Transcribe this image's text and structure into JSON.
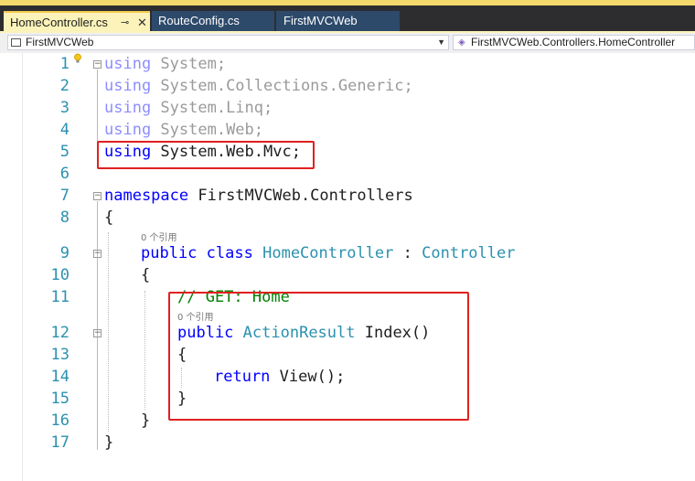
{
  "tabs": [
    {
      "label": "HomeController.cs",
      "active": true,
      "pin_icon": "pin-icon",
      "close_icon": "close-icon"
    },
    {
      "label": "RouteConfig.cs",
      "active": false
    },
    {
      "label": "FirstMVCWeb",
      "active": false
    }
  ],
  "navbar": {
    "project": "FirstMVCWeb",
    "type_scope": "FirstMVCWeb.Controllers.HomeController"
  },
  "editor": {
    "line_numbers": [
      "1",
      "2",
      "3",
      "4",
      "5",
      "6",
      "7",
      "8",
      "9",
      "10",
      "11",
      "12",
      "13",
      "14",
      "15",
      "16",
      "17"
    ],
    "lines": {
      "l1": {
        "kw": "using",
        "rest": " System;"
      },
      "l2": {
        "kw": "using",
        "rest": " System.Collections.Generic;"
      },
      "l3": {
        "kw": "using",
        "rest": " System.Linq;"
      },
      "l4": {
        "kw": "using",
        "rest": " System.Web;"
      },
      "l5": {
        "kw": "using",
        "rest": " System.Web.Mvc;"
      },
      "l7": {
        "kw": "namespace",
        "rest": " FirstMVCWeb.Controllers"
      },
      "l8": "{",
      "refs_class": "0 个引用",
      "l9": {
        "kw1": "public",
        "kw2": "class",
        "type1": "HomeController",
        "sep": " : ",
        "type2": "Controller"
      },
      "l10": "{",
      "l11": "// GET: Home",
      "refs_method": "0 个引用",
      "l12": {
        "kw": "public",
        "type": "ActionResult",
        "rest": " Index()"
      },
      "l13": "{",
      "l14": {
        "kw": "return",
        "rest": " View();"
      },
      "l15": "}",
      "l16": "}",
      "l17": "}"
    }
  },
  "colors": {
    "keyword": "#0000ff",
    "type": "#2b91af",
    "comment": "#008000",
    "highlight_box": "#e02020",
    "tab_active": "#fbf3b9",
    "tab_inactive": "#2d4a6b"
  }
}
